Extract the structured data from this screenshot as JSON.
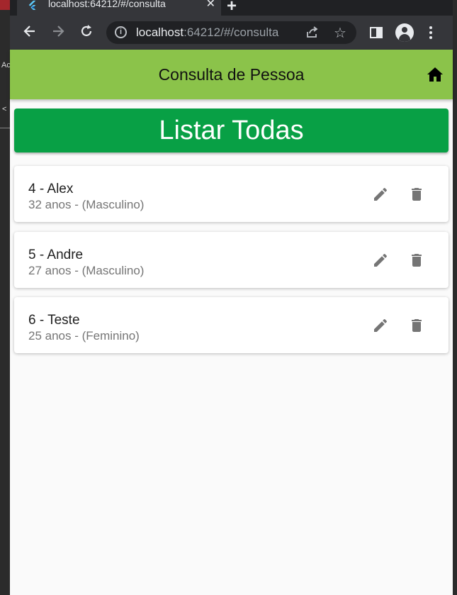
{
  "browser": {
    "tab_title": "localhost:64212/#/consulta",
    "url_host": "localhost",
    "url_rest": ":64212/#/consulta"
  },
  "app": {
    "title": "Consulta de Pessoa",
    "list_all_label": "Listar Todas"
  },
  "people": [
    {
      "name": "4 - Alex",
      "details": "32 anos - (Masculino)"
    },
    {
      "name": "5 - Andre",
      "details": "27 anos - (Masculino)"
    },
    {
      "name": "6 - Teste",
      "details": "25 anos - (Feminino)"
    }
  ],
  "side_text": {
    "left_label": "Ac",
    "left_arrow": "<"
  },
  "colors": {
    "appbar": "#8bc34a",
    "list_button": "#08a045",
    "icon_grey": "#757575"
  }
}
